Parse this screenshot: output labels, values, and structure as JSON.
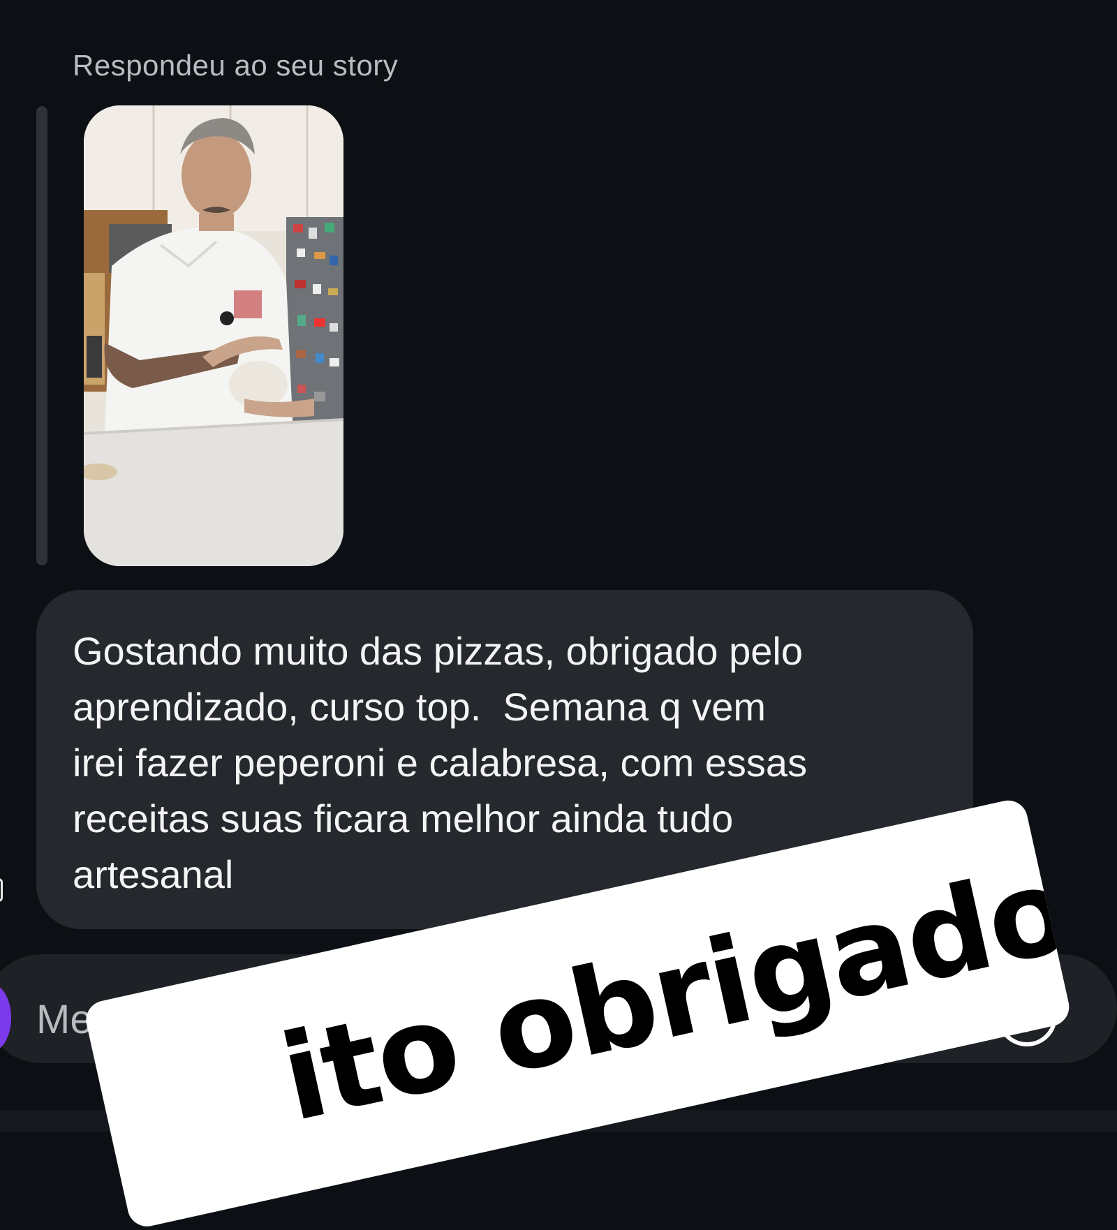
{
  "story_reply": {
    "caption": "Respondeu ao seu story",
    "thumbnail_alt": "story-video-thumbnail"
  },
  "message": {
    "text": "Gostando muito das pizzas, obrigado pelo\naprendizado, curso top.  Semana q vem\nirei fazer peperoni e calabresa, com essas\nreceitas suas ficara melhor ainda tudo\nartesanal"
  },
  "composer": {
    "placeholder": "Mensagem...",
    "value": "",
    "add_icon": "plus-circle-icon"
  },
  "sticker": {
    "text": "ito obrigado"
  },
  "colors": {
    "background": "#0c1014",
    "bubble": "#25282d",
    "composer": "#1e2125",
    "accent": "#7c3aed"
  }
}
